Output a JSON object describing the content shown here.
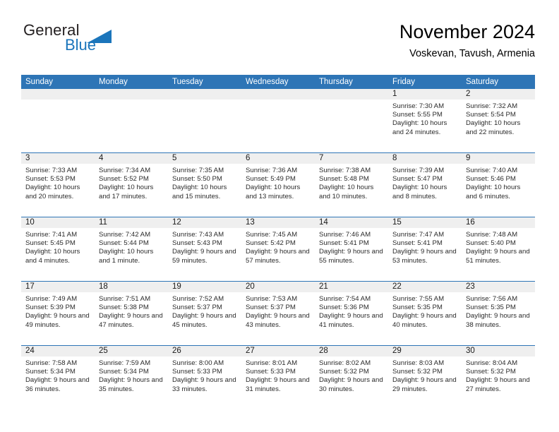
{
  "brand": {
    "name_top": "General",
    "name_bottom": "Blue",
    "triangle_color": "#1b75bb",
    "text_color": "#231f20"
  },
  "header": {
    "title": "November 2024",
    "subtitle": "Voskevan, Tavush, Armenia"
  },
  "theme": {
    "header_blue": "#2e75b6",
    "date_band_gray": "#efefef",
    "row_rule_blue": "#2e75b6"
  },
  "weekdays": [
    "Sunday",
    "Monday",
    "Tuesday",
    "Wednesday",
    "Thursday",
    "Friday",
    "Saturday"
  ],
  "weeks": [
    [
      {
        "day": "",
        "sunrise": "",
        "sunset": "",
        "daylight": ""
      },
      {
        "day": "",
        "sunrise": "",
        "sunset": "",
        "daylight": ""
      },
      {
        "day": "",
        "sunrise": "",
        "sunset": "",
        "daylight": ""
      },
      {
        "day": "",
        "sunrise": "",
        "sunset": "",
        "daylight": ""
      },
      {
        "day": "",
        "sunrise": "",
        "sunset": "",
        "daylight": ""
      },
      {
        "day": "1",
        "sunrise": "Sunrise: 7:30 AM",
        "sunset": "Sunset: 5:55 PM",
        "daylight": "Daylight: 10 hours and 24 minutes."
      },
      {
        "day": "2",
        "sunrise": "Sunrise: 7:32 AM",
        "sunset": "Sunset: 5:54 PM",
        "daylight": "Daylight: 10 hours and 22 minutes."
      }
    ],
    [
      {
        "day": "3",
        "sunrise": "Sunrise: 7:33 AM",
        "sunset": "Sunset: 5:53 PM",
        "daylight": "Daylight: 10 hours and 20 minutes."
      },
      {
        "day": "4",
        "sunrise": "Sunrise: 7:34 AM",
        "sunset": "Sunset: 5:52 PM",
        "daylight": "Daylight: 10 hours and 17 minutes."
      },
      {
        "day": "5",
        "sunrise": "Sunrise: 7:35 AM",
        "sunset": "Sunset: 5:50 PM",
        "daylight": "Daylight: 10 hours and 15 minutes."
      },
      {
        "day": "6",
        "sunrise": "Sunrise: 7:36 AM",
        "sunset": "Sunset: 5:49 PM",
        "daylight": "Daylight: 10 hours and 13 minutes."
      },
      {
        "day": "7",
        "sunrise": "Sunrise: 7:38 AM",
        "sunset": "Sunset: 5:48 PM",
        "daylight": "Daylight: 10 hours and 10 minutes."
      },
      {
        "day": "8",
        "sunrise": "Sunrise: 7:39 AM",
        "sunset": "Sunset: 5:47 PM",
        "daylight": "Daylight: 10 hours and 8 minutes."
      },
      {
        "day": "9",
        "sunrise": "Sunrise: 7:40 AM",
        "sunset": "Sunset: 5:46 PM",
        "daylight": "Daylight: 10 hours and 6 minutes."
      }
    ],
    [
      {
        "day": "10",
        "sunrise": "Sunrise: 7:41 AM",
        "sunset": "Sunset: 5:45 PM",
        "daylight": "Daylight: 10 hours and 4 minutes."
      },
      {
        "day": "11",
        "sunrise": "Sunrise: 7:42 AM",
        "sunset": "Sunset: 5:44 PM",
        "daylight": "Daylight: 10 hours and 1 minute."
      },
      {
        "day": "12",
        "sunrise": "Sunrise: 7:43 AM",
        "sunset": "Sunset: 5:43 PM",
        "daylight": "Daylight: 9 hours and 59 minutes."
      },
      {
        "day": "13",
        "sunrise": "Sunrise: 7:45 AM",
        "sunset": "Sunset: 5:42 PM",
        "daylight": "Daylight: 9 hours and 57 minutes."
      },
      {
        "day": "14",
        "sunrise": "Sunrise: 7:46 AM",
        "sunset": "Sunset: 5:41 PM",
        "daylight": "Daylight: 9 hours and 55 minutes."
      },
      {
        "day": "15",
        "sunrise": "Sunrise: 7:47 AM",
        "sunset": "Sunset: 5:41 PM",
        "daylight": "Daylight: 9 hours and 53 minutes."
      },
      {
        "day": "16",
        "sunrise": "Sunrise: 7:48 AM",
        "sunset": "Sunset: 5:40 PM",
        "daylight": "Daylight: 9 hours and 51 minutes."
      }
    ],
    [
      {
        "day": "17",
        "sunrise": "Sunrise: 7:49 AM",
        "sunset": "Sunset: 5:39 PM",
        "daylight": "Daylight: 9 hours and 49 minutes."
      },
      {
        "day": "18",
        "sunrise": "Sunrise: 7:51 AM",
        "sunset": "Sunset: 5:38 PM",
        "daylight": "Daylight: 9 hours and 47 minutes."
      },
      {
        "day": "19",
        "sunrise": "Sunrise: 7:52 AM",
        "sunset": "Sunset: 5:37 PM",
        "daylight": "Daylight: 9 hours and 45 minutes."
      },
      {
        "day": "20",
        "sunrise": "Sunrise: 7:53 AM",
        "sunset": "Sunset: 5:37 PM",
        "daylight": "Daylight: 9 hours and 43 minutes."
      },
      {
        "day": "21",
        "sunrise": "Sunrise: 7:54 AM",
        "sunset": "Sunset: 5:36 PM",
        "daylight": "Daylight: 9 hours and 41 minutes."
      },
      {
        "day": "22",
        "sunrise": "Sunrise: 7:55 AM",
        "sunset": "Sunset: 5:35 PM",
        "daylight": "Daylight: 9 hours and 40 minutes."
      },
      {
        "day": "23",
        "sunrise": "Sunrise: 7:56 AM",
        "sunset": "Sunset: 5:35 PM",
        "daylight": "Daylight: 9 hours and 38 minutes."
      }
    ],
    [
      {
        "day": "24",
        "sunrise": "Sunrise: 7:58 AM",
        "sunset": "Sunset: 5:34 PM",
        "daylight": "Daylight: 9 hours and 36 minutes."
      },
      {
        "day": "25",
        "sunrise": "Sunrise: 7:59 AM",
        "sunset": "Sunset: 5:34 PM",
        "daylight": "Daylight: 9 hours and 35 minutes."
      },
      {
        "day": "26",
        "sunrise": "Sunrise: 8:00 AM",
        "sunset": "Sunset: 5:33 PM",
        "daylight": "Daylight: 9 hours and 33 minutes."
      },
      {
        "day": "27",
        "sunrise": "Sunrise: 8:01 AM",
        "sunset": "Sunset: 5:33 PM",
        "daylight": "Daylight: 9 hours and 31 minutes."
      },
      {
        "day": "28",
        "sunrise": "Sunrise: 8:02 AM",
        "sunset": "Sunset: 5:32 PM",
        "daylight": "Daylight: 9 hours and 30 minutes."
      },
      {
        "day": "29",
        "sunrise": "Sunrise: 8:03 AM",
        "sunset": "Sunset: 5:32 PM",
        "daylight": "Daylight: 9 hours and 29 minutes."
      },
      {
        "day": "30",
        "sunrise": "Sunrise: 8:04 AM",
        "sunset": "Sunset: 5:32 PM",
        "daylight": "Daylight: 9 hours and 27 minutes."
      }
    ]
  ]
}
